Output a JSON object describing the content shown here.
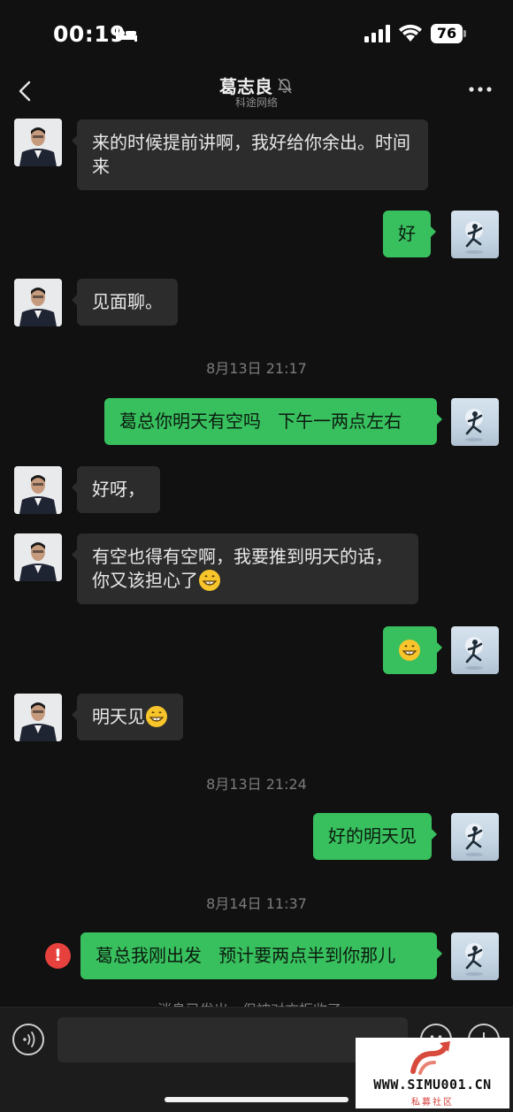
{
  "status_bar": {
    "time": "00:19",
    "battery": "76"
  },
  "header": {
    "title": "葛志良",
    "subtitle": "科途网络"
  },
  "messages": [
    {
      "text": "来的时候提前讲啊，我好给你余出。时间来"
    },
    {
      "text": "好"
    },
    {
      "text": "见面聊。"
    },
    {
      "timestamp": "8月13日 21:17"
    },
    {
      "text": "葛总你明天有空吗   下午一两点左右"
    },
    {
      "text": "好呀，"
    },
    {
      "text": "有空也得有空啊，我要推到明天的话，你又该担心了"
    },
    {
      "text": ""
    },
    {
      "text": "明天见"
    },
    {
      "timestamp": "8月13日 21:24"
    },
    {
      "text": "好的明天见"
    },
    {
      "timestamp": "8月14日 11:37"
    },
    {
      "text": "葛总我刚出发   预计要两点半到你那儿"
    }
  ],
  "error_mark": "!",
  "status_note": "消息已发出，但被对方拒收了。",
  "input": {
    "value": ""
  },
  "watermark": {
    "text": "WWW.SIMU001.CN",
    "subtitle": "私募社区"
  },
  "colors": {
    "sent_bubble": "#38c05e",
    "received_bubble": "#2c2c2c",
    "error": "#e7413d",
    "background": "#111111"
  },
  "icons": [
    "sleep-bed-icon",
    "signal-icon",
    "wifi-icon",
    "battery-icon",
    "back-chevron-icon",
    "mute-bell-icon",
    "more-dots-icon",
    "grinning-emoji-icon",
    "voice-icon",
    "emoji-icon",
    "plus-icon"
  ]
}
